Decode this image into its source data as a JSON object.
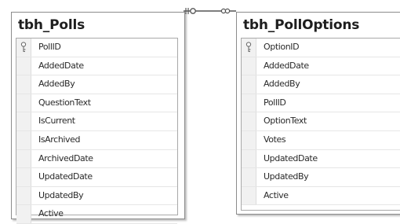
{
  "tables": [
    {
      "name": "tbh_Polls",
      "columns": [
        {
          "name": "PollID",
          "primary_key": true
        },
        {
          "name": "AddedDate",
          "primary_key": false
        },
        {
          "name": "AddedBy",
          "primary_key": false
        },
        {
          "name": "QuestionText",
          "primary_key": false
        },
        {
          "name": "IsCurrent",
          "primary_key": false
        },
        {
          "name": "IsArchived",
          "primary_key": false
        },
        {
          "name": "ArchivedDate",
          "primary_key": false
        },
        {
          "name": "UpdatedDate",
          "primary_key": false
        },
        {
          "name": "UpdatedBy",
          "primary_key": false
        },
        {
          "name": "Active",
          "primary_key": false
        }
      ]
    },
    {
      "name": "tbh_PollOptions",
      "columns": [
        {
          "name": "OptionID",
          "primary_key": true
        },
        {
          "name": "AddedDate",
          "primary_key": false
        },
        {
          "name": "AddedBy",
          "primary_key": false
        },
        {
          "name": "PollID",
          "primary_key": false
        },
        {
          "name": "OptionText",
          "primary_key": false
        },
        {
          "name": "Votes",
          "primary_key": false
        },
        {
          "name": "UpdatedDate",
          "primary_key": false
        },
        {
          "name": "UpdatedBy",
          "primary_key": false
        },
        {
          "name": "Active",
          "primary_key": false
        }
      ]
    }
  ],
  "relationship": {
    "one_end": "key",
    "many_end": "infinity"
  }
}
